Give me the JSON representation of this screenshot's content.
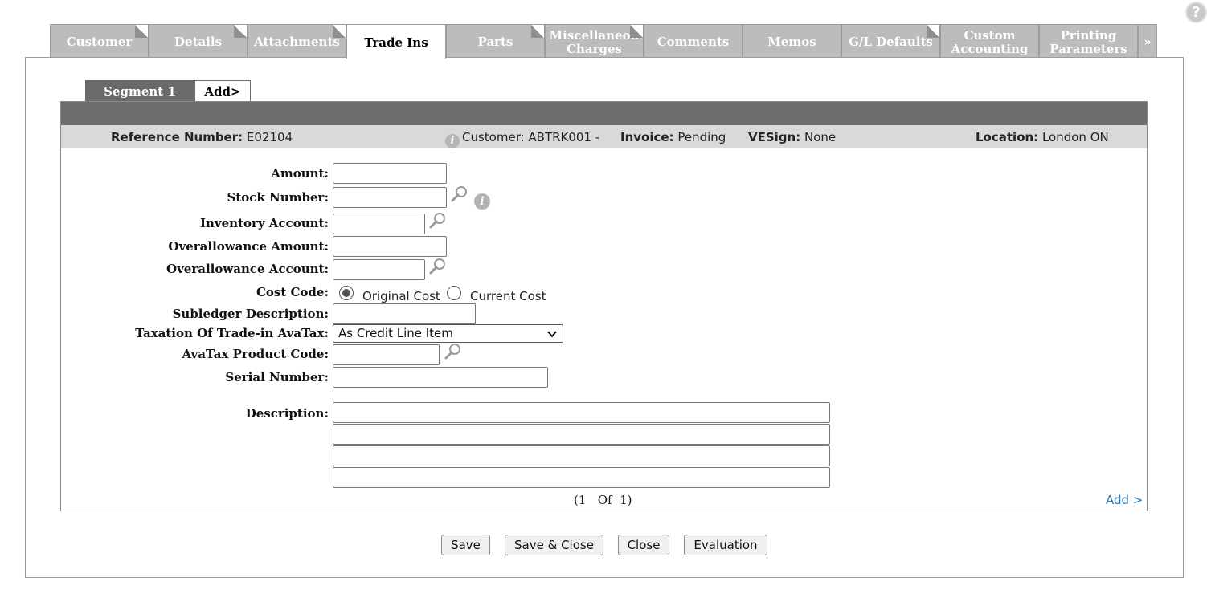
{
  "help": {
    "glyph": "?"
  },
  "tabs": [
    {
      "label": "Customer"
    },
    {
      "label": "Details"
    },
    {
      "label": "Attachments"
    },
    {
      "label": "Trade Ins",
      "active": true
    },
    {
      "label": "Parts"
    },
    {
      "label_line1": "Miscellaneou",
      "label_line2": "Charges"
    },
    {
      "label": "Comments"
    },
    {
      "label": "Memos"
    },
    {
      "label": "G/L Defaults"
    },
    {
      "label_line1": "Custom",
      "label_line2": "Accounting"
    },
    {
      "label_line1": "Printing",
      "label_line2": "Parameters"
    },
    {
      "label": "»"
    }
  ],
  "segments": {
    "active": "Segment 1",
    "add": "Add>"
  },
  "info": {
    "ref_label": "Reference Number:",
    "ref_value": "E02104",
    "customer_text": "Customer: ABTRK001  -",
    "invoice_label": "Invoice:",
    "invoice_value": "Pending",
    "vesign_label": "VESign:",
    "vesign_value": "None",
    "location_label": "Location:",
    "location_value": "London ON"
  },
  "form": {
    "amount_label": "Amount:",
    "amount_value": "",
    "stock_label": "Stock Number:",
    "stock_value": "",
    "inventory_label": "Inventory Account:",
    "inventory_value": "",
    "overallowance_amount_label": "Overallowance Amount:",
    "overallowance_amount_value": "",
    "overallowance_account_label": "Overallowance Account:",
    "overallowance_account_value": "",
    "cost_code_label": "Cost Code:",
    "cost_original": "Original Cost",
    "cost_current": "Current Cost",
    "cost_selected": "Original Cost",
    "subledger_label": "Subledger Description:",
    "subledger_value": "",
    "taxation_label": "Taxation Of Trade-in AvaTax:",
    "taxation_value": "As Credit Line Item",
    "avatax_label": "AvaTax Product Code:",
    "avatax_value": "",
    "serial_label": "Serial Number:",
    "serial_value": "",
    "description_label": "Description:",
    "description_lines": [
      "",
      "",
      "",
      ""
    ]
  },
  "pager": "(1   Of  1)",
  "add_link": "Add >",
  "buttons": {
    "save": "Save",
    "save_close": "Save & Close",
    "close": "Close",
    "evaluation": "Evaluation"
  },
  "icons": {
    "lookup": "magnifier-icon",
    "info": "info-icon",
    "help": "help-icon"
  }
}
